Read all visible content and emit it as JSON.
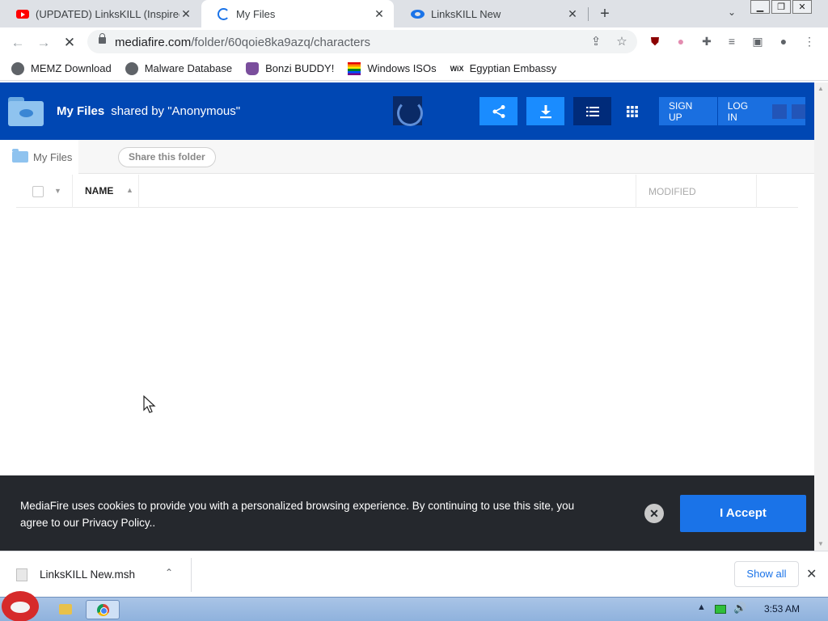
{
  "tabs": [
    {
      "title": "(UPDATED) LinksKILL (Inspired",
      "icon": "youtube-icon"
    },
    {
      "title": "My Files",
      "icon": "loading-spinner-icon"
    },
    {
      "title": "LinksKILL New",
      "icon": "mediafire-icon"
    }
  ],
  "address": {
    "host": "mediafire.com",
    "path": "/folder/60qoie8ka9azq/characters"
  },
  "bookmarks": [
    {
      "label": "MEMZ Download",
      "icon": "globe-icon"
    },
    {
      "label": "Malware Database",
      "icon": "globe-icon"
    },
    {
      "label": "Bonzi BUDDY!",
      "icon": "bonzi-icon"
    },
    {
      "label": "Windows ISOs",
      "icon": "rainbow-flag-icon"
    },
    {
      "label": "Egyptian Embassy",
      "icon": "wix-icon"
    }
  ],
  "bookmark_wix_glyph": "WiX",
  "header": {
    "title": "My Files",
    "shared_by": "shared by \"Anonymous\"",
    "signup": "SIGN UP",
    "login": "LOG IN"
  },
  "breadcrumb": {
    "label": "My Files",
    "share_button": "Share this folder"
  },
  "table": {
    "col_name": "NAME",
    "col_modified": "MODIFIED"
  },
  "cookie": {
    "text": "MediaFire uses cookies to provide you with a personalized browsing experience. By continuing to use this site, you agree to our Privacy Policy..",
    "accept": "I Accept"
  },
  "download": {
    "filename": "LinksKILL New.msh",
    "show_all": "Show all"
  },
  "taskbar": {
    "time": "3:53 AM"
  },
  "colors": {
    "mediafire_header": "#0047b3",
    "accent_blue": "#1a8cff",
    "cookie_bg": "#25282d"
  }
}
